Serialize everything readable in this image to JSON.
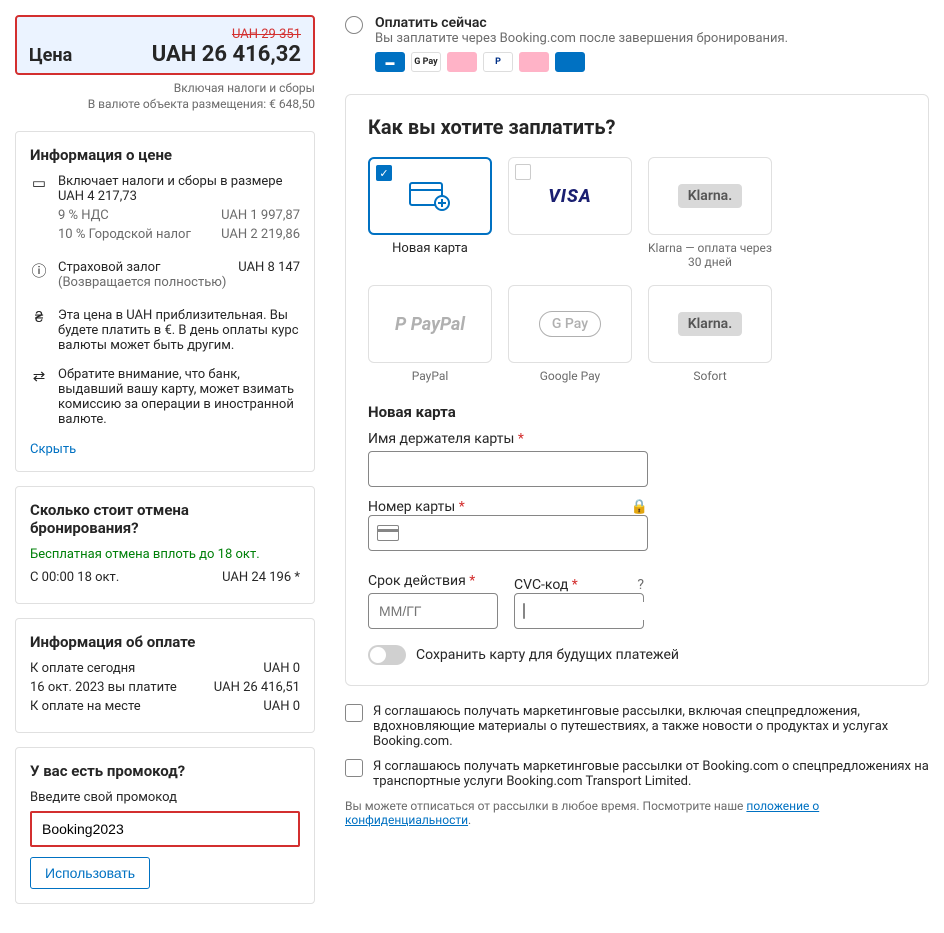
{
  "price": {
    "label": "Цена",
    "old_price": "UAH 29 351",
    "current": "UAH 26 416,32",
    "note1": "Включая налоги и сборы",
    "note2": "В валюте объекта размещения: € 648,50"
  },
  "price_info": {
    "heading": "Информация о цене",
    "taxes_line": "Включает налоги и сборы в размере UAH 4 217,73",
    "vat_label": "9 % НДС",
    "vat_value": "UAH 1 997,87",
    "city_label": "10 % Городской налог",
    "city_value": "UAH 2 219,86",
    "deposit_label": "Страховой залог",
    "deposit_sub": "(Возвращается полностью)",
    "deposit_value": "UAH 8 147",
    "approx_note": "Эта цена в UAH приблизительная. Вы будете платить в €. В день оплаты курс валюты может быть другим.",
    "bank_note": "Обратите внимание, что банк, выдавший вашу карту, может взимать комиссию за операции в иностранной валюте.",
    "hide_link": "Скрыть"
  },
  "cancel": {
    "heading": "Сколько стоит отмена бронирования?",
    "free_line": "Бесплатная отмена вплоть до 18 окт.",
    "from_label": "С 00:00 18 окт.",
    "from_value": "UAH 24 196 *"
  },
  "pay_info": {
    "heading": "Информация об оплате",
    "today_label": "К оплате сегодня",
    "today_value": "UAH 0",
    "later_label": "16 окт. 2023 вы платите",
    "later_value": "UAH 26 416,51",
    "onsite_label": "К оплате на месте",
    "onsite_value": "UAH 0"
  },
  "promo": {
    "heading": "У вас есть промокод?",
    "sub": "Введите свой промокод",
    "value": "Booking2023",
    "apply": "Использовать"
  },
  "paynow": {
    "title": "Оплатить сейчас",
    "desc": "Вы заплатите через Booking.com после завершения бронирования."
  },
  "how": {
    "heading": "Как вы хотите заплатить?",
    "methods": {
      "new_card": "Новая карта",
      "visa": "VISA",
      "klarna": "Klarna.",
      "klarna_desc": "Klarna — оплата через 30 дней",
      "paypal": "PayPal",
      "gpay": "Google Pay",
      "gpay_logo": "G Pay",
      "sofort": "Sofort"
    }
  },
  "card_form": {
    "section": "Новая карта",
    "holder": "Имя держателя карты",
    "number": "Номер карты",
    "exp": "Срок действия",
    "exp_ph": "ММ/ГГ",
    "cvc": "CVC-код",
    "save_label": "Сохранить карту для будущих платежей"
  },
  "consents": {
    "c1": "Я соглашаюсь получать маркетинговые рассылки, включая спецпредложения, вдохновляющие материалы о путешествиях, а также новости о продуктах и услугах Booking.com.",
    "c2": "Я соглашаюсь получать маркетинговые рассылки от Booking.com о спецпредложениях на транспортные услуги Booking.com Transport Limited.",
    "fine_pre": "Вы можете отписаться от рассылки в любое время. Посмотрите наше ",
    "fine_link": "положение о конфиденциальности",
    "fine_post": "."
  }
}
